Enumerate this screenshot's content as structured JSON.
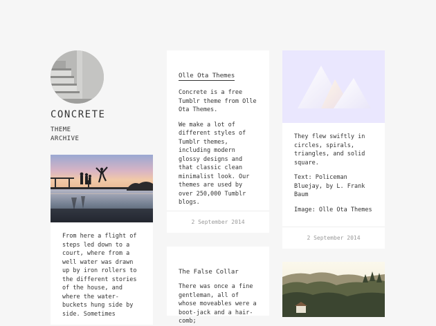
{
  "sidebar": {
    "title": "CONCRETE",
    "links": [
      "THEME",
      "ARCHIVE"
    ]
  },
  "posts": [
    {
      "type": "photo",
      "caption": "From here a flight of steps led down to a court, where from a well water was drawn up by iron rollers to the different stories of the house, and where the water-buckets hung side by side. Sometimes"
    },
    {
      "type": "text",
      "title": "Olle Ota Themes",
      "paragraphs": [
        "Concrete is a free Tumblr theme from Olle Ota Themes.",
        "We make a lot of different styles of Tumblr themes, including modern glossy designs and that classic clean minimalist look. Our themes are used by over 250,000 Tumblr blogs."
      ],
      "date": "2 September 2014"
    },
    {
      "type": "text",
      "title": "The False Collar",
      "paragraphs": [
        "There was once a fine gentleman, all of whose moveables were a boot-jack and a hair-comb;"
      ]
    },
    {
      "type": "quote",
      "paragraphs": [
        "They flew swiftly in circles, spirals, triangles, and solid square.",
        "Text: Policeman Bluejay, by L. Frank Baum",
        "Image: Olle Ota Themes"
      ],
      "date": "2 September 2014"
    },
    {
      "type": "photo"
    }
  ]
}
